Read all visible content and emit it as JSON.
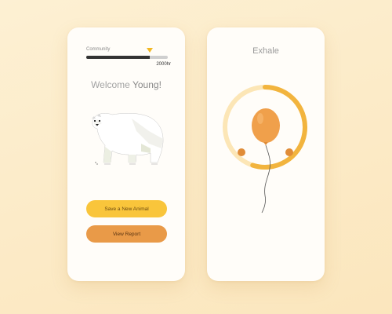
{
  "left_screen": {
    "community_label": "Community",
    "progress_fraction": 0.78,
    "hours_label": "2000hr",
    "welcome_prefix": "Welcome",
    "welcome_name": "Young!",
    "save_button": "Save a New Animal",
    "report_button": "View Report"
  },
  "right_screen": {
    "title": "Exhale",
    "breath_progress_fraction": 0.55
  },
  "colors": {
    "background": "#fbe9c4",
    "accent_yellow": "#f9c53b",
    "accent_orange": "#e99a48",
    "balloon": "#f0a04b",
    "progress_dark": "#333333"
  },
  "icons": {
    "mascot": "polar-bear-illustration",
    "breath": "balloon-icon",
    "marker": "triangle-marker-icon"
  }
}
